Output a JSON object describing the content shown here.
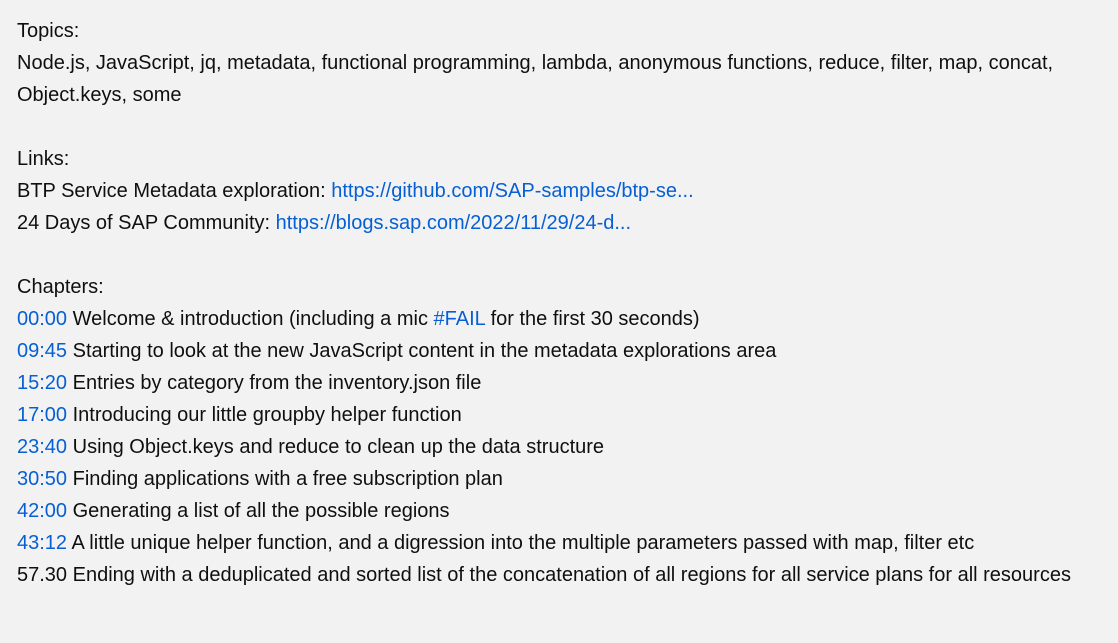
{
  "topics": {
    "heading": "Topics:",
    "text": "Node.js, JavaScript, jq, metadata, functional programming, lambda, anonymous functions, reduce, filter, map, concat, Object.keys, some"
  },
  "links": {
    "heading": "Links:",
    "items": [
      {
        "label": "BTP Service Metadata exploration: ",
        "url": "https://github.com/SAP-samples/btp-se..."
      },
      {
        "label": "24 Days of SAP Community: ",
        "url": "https://blogs.sap.com/2022/11/29/24-d..."
      }
    ]
  },
  "chapters": {
    "heading": "Chapters:",
    "items": [
      {
        "time": "00:00",
        "text_before": " Welcome & introduction (including a mic ",
        "hashtag": "#FAIL",
        "text_after": " for the first 30 seconds)"
      },
      {
        "time": "09:45",
        "text": " Starting to look at the new JavaScript content in the metadata explorations area"
      },
      {
        "time": "15:20",
        "text": " Entries by category from the inventory.json file"
      },
      {
        "time": "17:00",
        "text": " Introducing our little groupby helper function"
      },
      {
        "time": "23:40",
        "text": " Using Object.keys and reduce to clean up the data structure"
      },
      {
        "time": "30:50",
        "text": " Finding applications with a free subscription plan"
      },
      {
        "time": "42:00",
        "text": " Generating a list of all the possible regions"
      },
      {
        "time": "43:12",
        "text": " A little unique helper function, and a digression into the multiple parameters passed with map, filter etc"
      }
    ],
    "final_line": "57.30 Ending with a deduplicated and sorted list of the concatenation of all regions for all service plans for all resources"
  },
  "colors": {
    "background": "#f2f2f2",
    "text": "#0f0f0f",
    "link": "#065fd4"
  }
}
